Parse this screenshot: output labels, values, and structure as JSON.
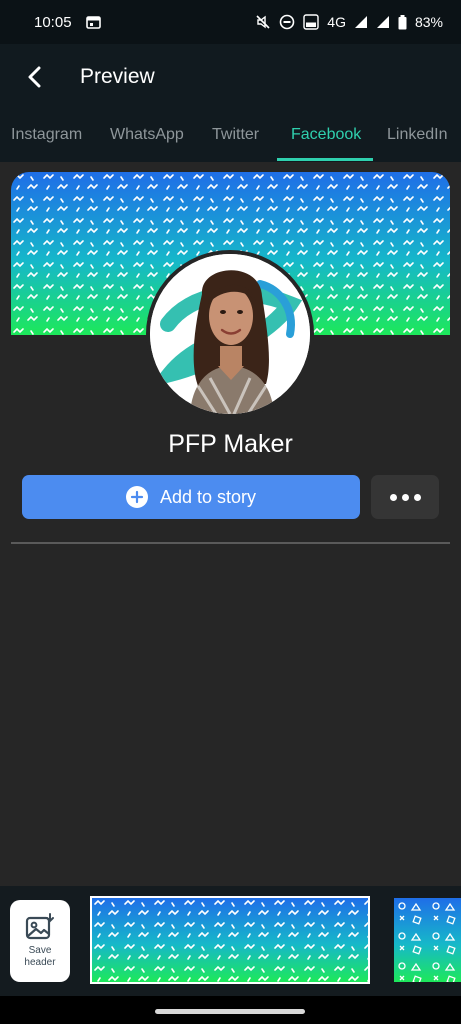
{
  "status_bar": {
    "time": "10:05",
    "network": "4G",
    "battery": "83%",
    "icons": [
      "calendar-icon",
      "mute-icon",
      "do-not-disturb-icon",
      "volte-icon",
      "signal-icon",
      "battery-icon"
    ]
  },
  "app_bar": {
    "title": "Preview",
    "back_icon": "back-arrow-icon"
  },
  "tabs": [
    {
      "label": "Instagram",
      "active": false
    },
    {
      "label": "WhatsApp",
      "active": false
    },
    {
      "label": "Twitter",
      "active": false
    },
    {
      "label": "Facebook",
      "active": true
    },
    {
      "label": "LinkedIn",
      "active": false
    }
  ],
  "profile": {
    "name": "PFP Maker",
    "add_story_label": "Add to story",
    "more_icon": "more-horizontal-icon"
  },
  "picker": {
    "save_label_line1": "Save",
    "save_label_line2": "header",
    "save_icon": "save-image-icon"
  },
  "colors": {
    "accent": "#2fd0ae",
    "button_blue": "#4c8cf0",
    "gradient_top": "#1f6ee8",
    "gradient_mid": "#16b8c9",
    "gradient_bottom": "#1de85a"
  }
}
